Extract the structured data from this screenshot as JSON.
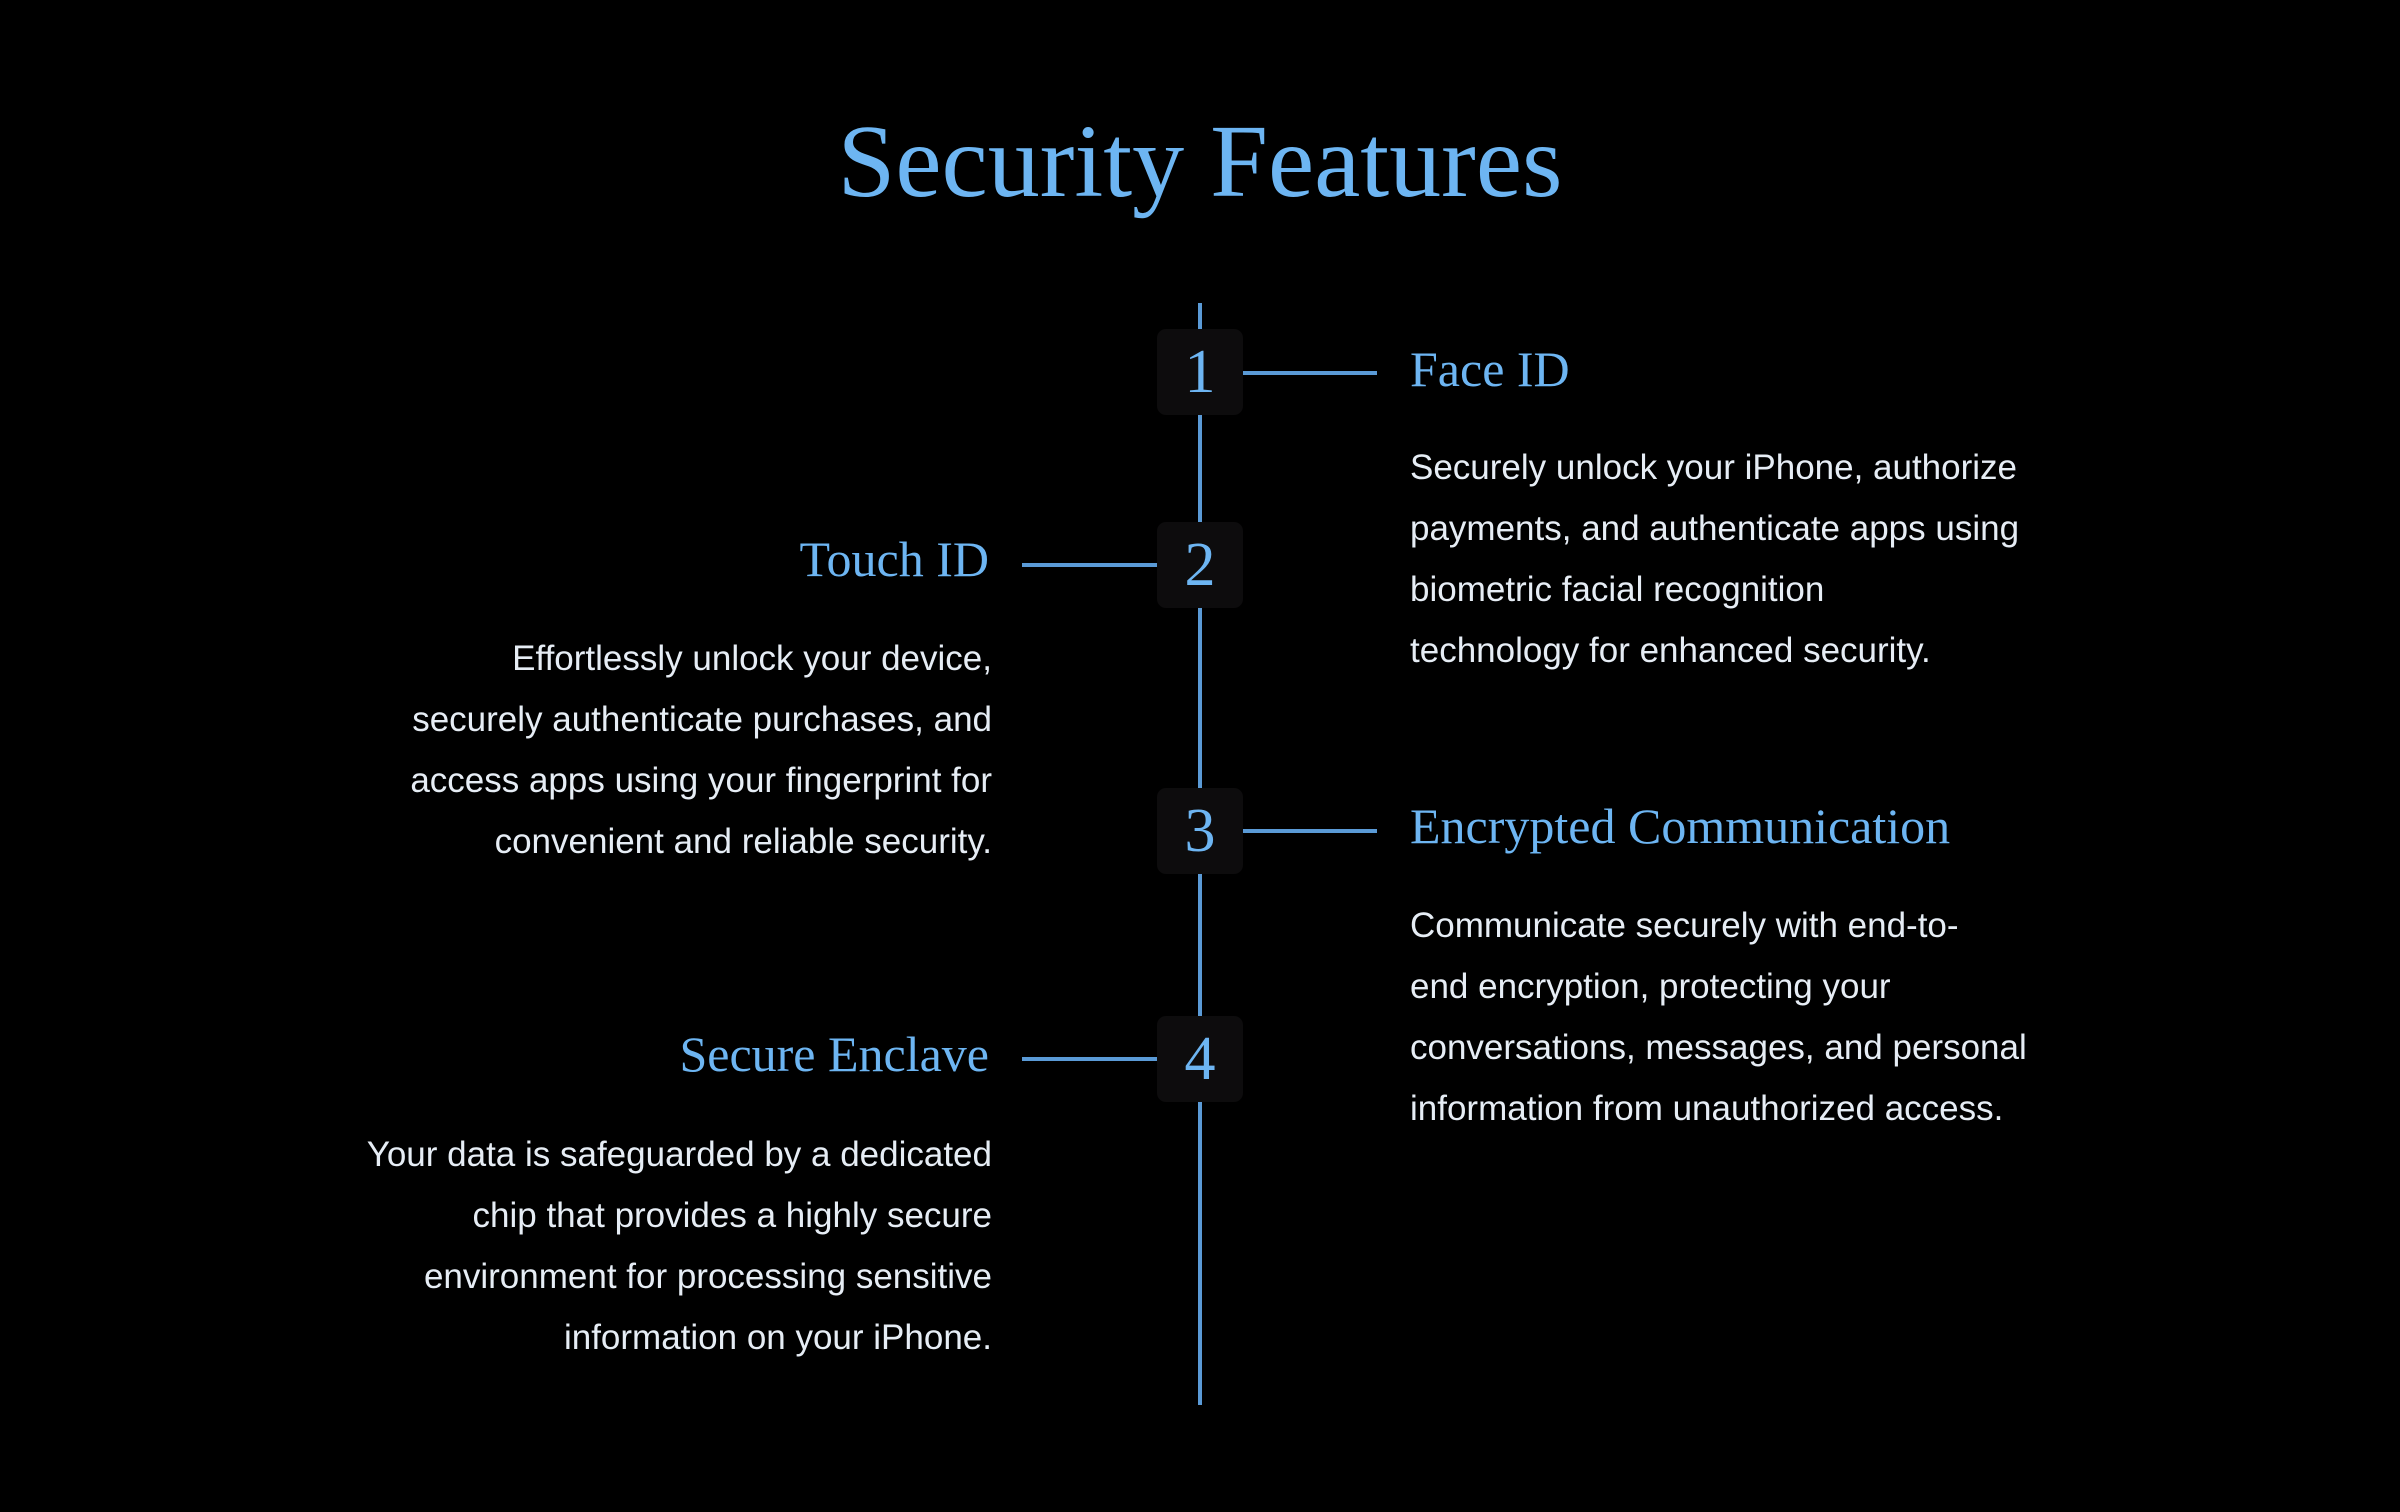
{
  "title": "Security Features",
  "colors": {
    "accent": "#6db5f2",
    "line": "#5a9ad6",
    "background": "#000000",
    "box": "#0d0c0d",
    "text": "#e6edf5"
  },
  "features": [
    {
      "number": "1",
      "title": "Face ID",
      "side": "right",
      "lines": [
        "Securely unlock your iPhone, authorize",
        "payments, and authenticate apps using",
        "biometric facial recognition",
        "technology for enhanced security."
      ]
    },
    {
      "number": "2",
      "title": "Touch ID",
      "side": "left",
      "lines": [
        "Effortlessly unlock your device,",
        "securely authenticate purchases, and",
        "access apps using your fingerprint for",
        "convenient and reliable security."
      ]
    },
    {
      "number": "3",
      "title": "Encrypted Communication",
      "side": "right",
      "lines": [
        "Communicate securely with end-to-",
        "end encryption, protecting your",
        "conversations, messages, and personal",
        "information from unauthorized access."
      ]
    },
    {
      "number": "4",
      "title": "Secure Enclave",
      "side": "left",
      "lines": [
        "Your data is safeguarded by a dedicated",
        "chip that provides a highly secure",
        "environment for processing sensitive",
        "information on your iPhone."
      ]
    }
  ]
}
